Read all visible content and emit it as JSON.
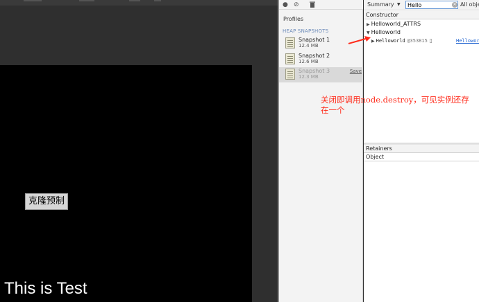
{
  "game": {
    "clone_button_label": "克隆预制",
    "label_text": "This is Test"
  },
  "profiles": {
    "toolbar": {
      "record_icon": "record-icon",
      "clear_icon": "clear-icon",
      "trash_icon": "trash-icon"
    },
    "title": "Profiles",
    "section_title": "HEAP SNAPSHOTS",
    "snapshots": [
      {
        "name": "Snapshot 1",
        "size": "12.4 MB"
      },
      {
        "name": "Snapshot 2",
        "size": "12.6 MB"
      },
      {
        "name": "Snapshot 3",
        "size": "12.3 MB",
        "selected": true,
        "action": "Save"
      }
    ]
  },
  "heap_view": {
    "view_mode": "Summary",
    "search_value": "Hello",
    "filter_label": "All objects",
    "columns": {
      "constructor": "Constructor",
      "retainers": "Retainers",
      "object": "Object"
    },
    "rows": [
      {
        "label": "Helloworld_ATTRS",
        "expanded": false
      },
      {
        "label": "Helloworld",
        "expanded": true
      },
      {
        "label": "Helloworld",
        "id": "@353815",
        "link": "Helloworld"
      }
    ]
  },
  "annotation": {
    "text": "关闭即调用node.destroy，可见实例还存在一个",
    "color": "#ff2a1a"
  }
}
